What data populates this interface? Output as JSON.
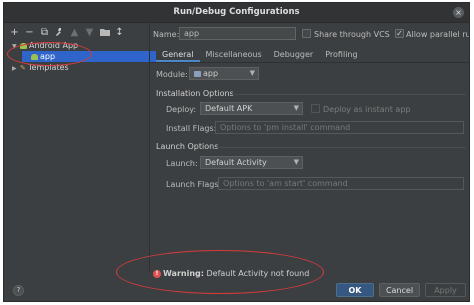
{
  "window": {
    "title": "Run/Debug Configurations",
    "close_glyph": "×"
  },
  "toolbar": [
    {
      "icon": "add-icon",
      "glyph": "+"
    },
    {
      "icon": "remove-icon",
      "glyph": "−"
    },
    {
      "icon": "copy-icon",
      "glyph": "⧉"
    },
    {
      "icon": "wrench-icon",
      "glyph": "🔧"
    },
    {
      "icon": "move-up-icon",
      "glyph": "▲"
    },
    {
      "icon": "move-down-icon",
      "glyph": "▼"
    },
    {
      "icon": "folder-icon",
      "glyph": "▬"
    },
    {
      "icon": "sort-icon",
      "glyph": "↕"
    }
  ],
  "tree": {
    "android_app": "Android App",
    "app": "app",
    "templates": "Templates"
  },
  "name": {
    "label": "Name:",
    "value": "app"
  },
  "share_vcs": {
    "label": "Share through VCS",
    "checked": false
  },
  "allow_parallel": {
    "label": "Allow parallel run",
    "checked": true
  },
  "tabs": [
    "General",
    "Miscellaneous",
    "Debugger",
    "Profiling"
  ],
  "module": {
    "label": "Module:",
    "value": "app"
  },
  "installation": {
    "section": "Installation Options",
    "deploy_label": "Deploy:",
    "deploy_value": "Default APK",
    "instant_label": "Deploy as instant app",
    "install_flags_label": "Install Flags:",
    "install_flags_placeholder": "Options to 'pm install' command"
  },
  "launch": {
    "section": "Launch Options",
    "launch_label": "Launch:",
    "launch_value": "Default Activity",
    "launch_flags_label": "Launch Flags:",
    "launch_flags_placeholder": "Options to 'am start' command"
  },
  "warning": {
    "bold": "Warning:",
    "text": " Default Activity not found"
  },
  "buttons": {
    "help": "?",
    "ok": "OK",
    "cancel": "Cancel",
    "apply": "Apply"
  },
  "colors": {
    "accent": "#2f65ca",
    "warning": "#e05252",
    "annotation": "#d63b3b"
  }
}
